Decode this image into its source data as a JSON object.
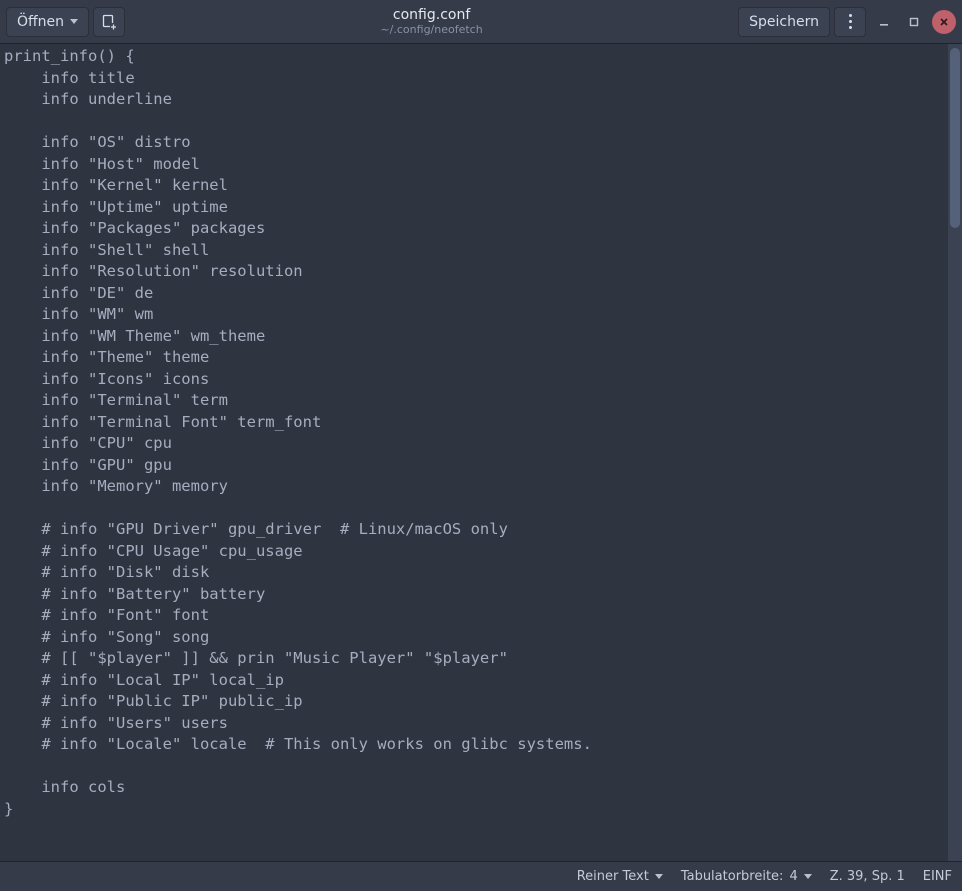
{
  "header": {
    "open_label": "Öffnen",
    "save_label": "Speichern",
    "filename": "config.conf",
    "filepath": "~/.config/neofetch"
  },
  "editor": {
    "content": "print_info() {\n    info title\n    info underline\n\n    info \"OS\" distro\n    info \"Host\" model\n    info \"Kernel\" kernel\n    info \"Uptime\" uptime\n    info \"Packages\" packages\n    info \"Shell\" shell\n    info \"Resolution\" resolution\n    info \"DE\" de\n    info \"WM\" wm\n    info \"WM Theme\" wm_theme\n    info \"Theme\" theme\n    info \"Icons\" icons\n    info \"Terminal\" term\n    info \"Terminal Font\" term_font\n    info \"CPU\" cpu\n    info \"GPU\" gpu\n    info \"Memory\" memory\n\n    # info \"GPU Driver\" gpu_driver  # Linux/macOS only\n    # info \"CPU Usage\" cpu_usage\n    # info \"Disk\" disk\n    # info \"Battery\" battery\n    # info \"Font\" font\n    # info \"Song\" song\n    # [[ \"$player\" ]] && prin \"Music Player\" \"$player\"\n    # info \"Local IP\" local_ip\n    # info \"Public IP\" public_ip\n    # info \"Users\" users\n    # info \"Locale\" locale  # This only works on glibc systems.\n\n    info cols\n}"
  },
  "statusbar": {
    "syntax": "Reiner Text",
    "tabwidth_label": "Tabulatorbreite:",
    "tabwidth_value": "4",
    "cursor": "Z. 39, Sp. 1",
    "insert_mode": "EINF"
  }
}
